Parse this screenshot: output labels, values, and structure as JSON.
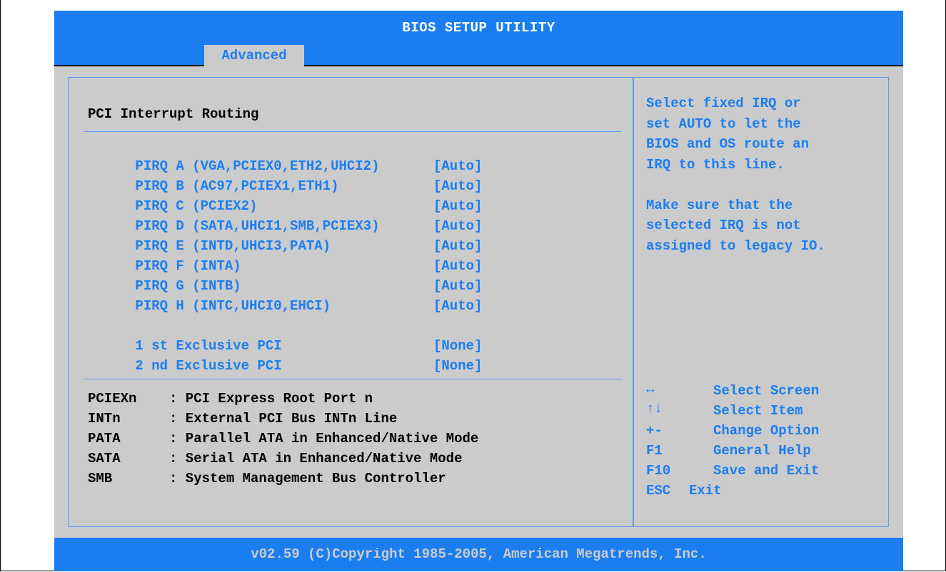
{
  "title": "BIOS SETUP UTILITY",
  "tabs": [
    {
      "label": "Advanced",
      "selected": true
    }
  ],
  "section_title": "PCI Interrupt Routing",
  "options": [
    {
      "label": "PIRQ A (VGA,PCIEX0,ETH2,UHCI2)",
      "value": "[Auto]"
    },
    {
      "label": "PIRQ B (AC97,PCIEX1,ETH1)",
      "value": "[Auto]"
    },
    {
      "label": "PIRQ C (PCIEX2)",
      "value": "[Auto]"
    },
    {
      "label": "PIRQ D (SATA,UHCI1,SMB,PCIEX3)",
      "value": "[Auto]"
    },
    {
      "label": "PIRQ E (INTD,UHCI3,PATA)",
      "value": "[Auto]"
    },
    {
      "label": "PIRQ F (INTA)",
      "value": "[Auto]"
    },
    {
      "label": "PIRQ G (INTB)",
      "value": "[Auto]"
    },
    {
      "label": "PIRQ H (INTC,UHCI0,EHCI)",
      "value": "[Auto]"
    },
    {
      "label": "1 st Exclusive PCI",
      "value": "[None]"
    },
    {
      "label": "2 nd Exclusive PCI",
      "value": "[None]"
    }
  ],
  "legend": [
    {
      "term": "PCIEXn",
      "desc": ": PCI Express Root Port n"
    },
    {
      "term": "INTn",
      "desc": ": External PCI Bus INTn Line"
    },
    {
      "term": "PATA",
      "desc": ": Parallel ATA in Enhanced/Native Mode"
    },
    {
      "term": "SATA",
      "desc": ": Serial ATA in Enhanced/Native Mode"
    },
    {
      "term": "SMB",
      "desc": ": System Management Bus Controller"
    }
  ],
  "help_text": "Select fixed IRQ or\nset AUTO to let the\nBIOS and OS route an\nIRQ to this line.\n\nMake sure that the\nselected IRQ is not\nassigned to legacy IO.",
  "keys": [
    {
      "key": "↔",
      "action": "Select Screen",
      "icon": "left-right-arrow-icon"
    },
    {
      "key": "↑↓",
      "action": "Select Item",
      "icon": "up-down-arrow-icon"
    },
    {
      "key": "+-",
      "action": "Change Option"
    },
    {
      "key": "F1",
      "action": "General Help"
    },
    {
      "key": "F10",
      "action": "Save and Exit"
    },
    {
      "key": "ESC",
      "action": "Exit"
    }
  ],
  "footer": "v02.59 (C)Copyright 1985-2005, American Megatrends, Inc.",
  "colors": {
    "accent": "#1a7ef0",
    "panel": "#cbcbcb",
    "text": "#000000"
  }
}
